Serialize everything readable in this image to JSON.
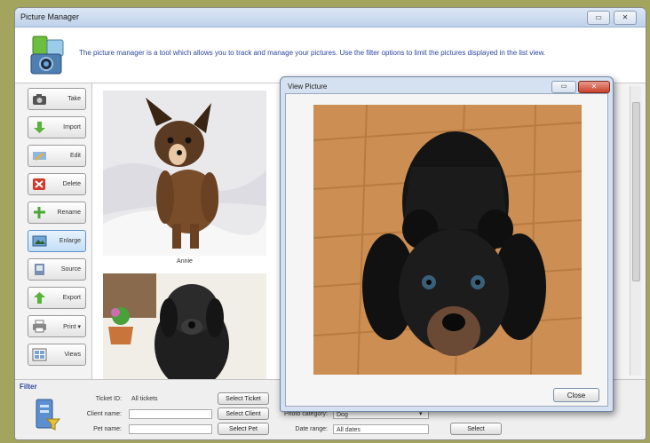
{
  "window": {
    "title": "Picture Manager",
    "restore_glyph": "▭",
    "close_glyph": "✕"
  },
  "banner": {
    "logo_icon": "camera-photos-icon",
    "description": "The picture manager is a tool which allows you to track and manage your pictures. Use the filter options to limit the pictures displayed in the list view."
  },
  "sidebar": {
    "items": [
      {
        "label": "Take",
        "icon": "camera-icon"
      },
      {
        "label": "Import",
        "icon": "import-arrow-icon"
      },
      {
        "label": "Edit",
        "icon": "edit-icon"
      },
      {
        "label": "Delete",
        "icon": "delete-icon"
      },
      {
        "label": "Rename",
        "icon": "rename-icon"
      },
      {
        "label": "Enlarge",
        "icon": "enlarge-icon"
      },
      {
        "label": "Source",
        "icon": "source-icon"
      },
      {
        "label": "Export",
        "icon": "export-arrow-icon"
      },
      {
        "label": "Print ▾",
        "icon": "print-icon"
      },
      {
        "label": "Views",
        "icon": "views-icon"
      }
    ]
  },
  "thumbnails": [
    {
      "caption": "Annie"
    },
    {
      "caption": ""
    }
  ],
  "viewer": {
    "title": "View Picture",
    "close_label": "Close"
  },
  "filter": {
    "title": "Filter",
    "icon": "filter-folder-icon",
    "ticket_label": "Ticket ID:",
    "ticket_value": "All tickets",
    "client_label": "Client name:",
    "client_value": "",
    "pet_label": "Pet name:",
    "pet_value": "",
    "select_ticket": "Select Ticket",
    "select_client": "Select Client",
    "select_pet": "Select Pet",
    "category_label": "Photo category:",
    "category_value": "Dog",
    "date_label": "Date range:",
    "date_value": "All dates",
    "select_btn": "Select"
  },
  "colors": {
    "accent": "#2c46a0",
    "active_button": "#c4def7",
    "desktop": "#a3a55f"
  }
}
